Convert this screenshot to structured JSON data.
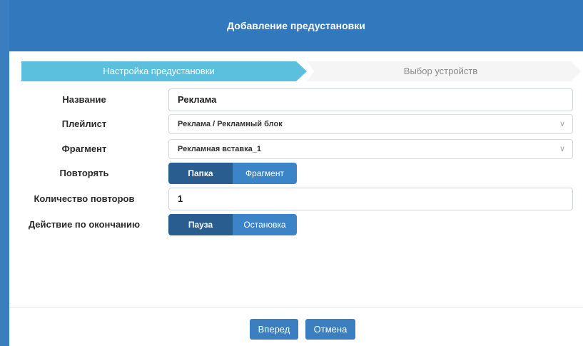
{
  "dialog": {
    "title": "Добавление предустановки"
  },
  "wizard": {
    "steps": [
      {
        "label": "Настройка предустановки",
        "active": true
      },
      {
        "label": "Выбор устройств",
        "active": false
      }
    ]
  },
  "form": {
    "name": {
      "label": "Название",
      "value": "Реклама"
    },
    "playlist": {
      "label": "Плейлист",
      "value": "Реклама / Рекламный блок"
    },
    "fragment": {
      "label": "Фрагмент",
      "value": "Рекламная вставка_1"
    },
    "repeat": {
      "label": "Повторять",
      "options": [
        "Папка",
        "Фрагмент"
      ],
      "selected": "Папка"
    },
    "repeat_count": {
      "label": "Количество повторов",
      "value": "1"
    },
    "end_action": {
      "label": "Действие по окончанию",
      "options": [
        "Пауза",
        "Остановка"
      ],
      "selected": "Пауза"
    }
  },
  "footer": {
    "next_label": "Вперед",
    "cancel_label": "Отмена"
  },
  "colors": {
    "header": "#3278bd",
    "step_active": "#5bc0de",
    "segment_active": "#2a5d8f",
    "segment_inactive": "#3c84c8",
    "button": "#3b7fc1"
  }
}
